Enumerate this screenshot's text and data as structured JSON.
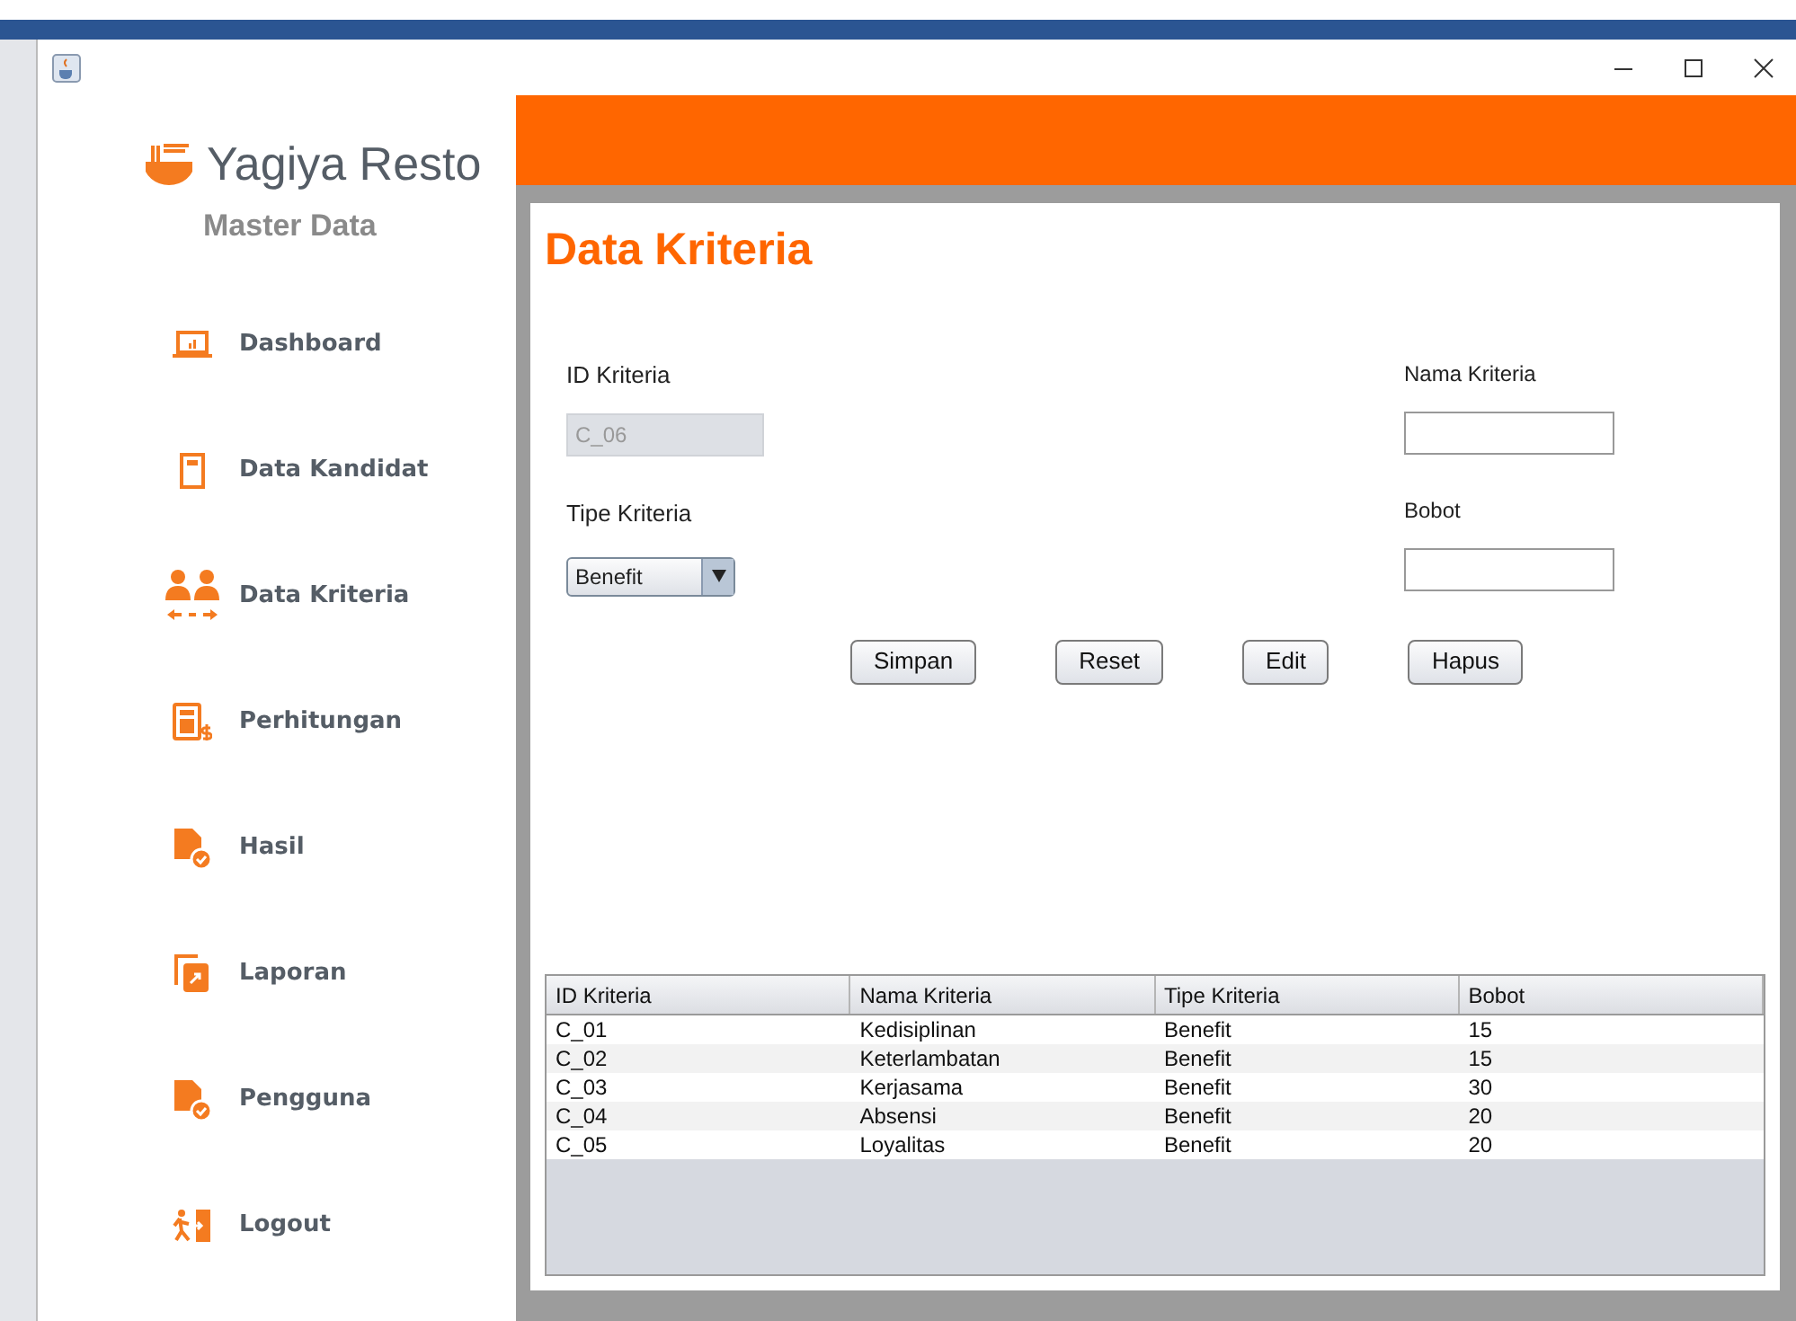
{
  "app": {
    "name": "Yagiya Resto",
    "section": "Master Data"
  },
  "sidebar": {
    "items": [
      {
        "label": "Dashboard",
        "kind": "laptop"
      },
      {
        "label": "Data Kandidat",
        "kind": "card"
      },
      {
        "label": "Data Kriteria",
        "kind": "people"
      },
      {
        "label": "Perhitungan",
        "kind": "calculator"
      },
      {
        "label": "Hasil",
        "kind": "doccheck"
      },
      {
        "label": "Laporan",
        "kind": "copy"
      },
      {
        "label": "Pengguna",
        "kind": "doccheck"
      },
      {
        "label": "Logout",
        "kind": "exit"
      }
    ]
  },
  "page": {
    "title": "Data Kriteria"
  },
  "form": {
    "id_label": "ID Kriteria",
    "id_value": "C_06",
    "id_disabled": true,
    "type_label": "Tipe Kriteria",
    "type_value": "Benefit",
    "name_label": "Nama Kriteria",
    "weight_label": "Bobot"
  },
  "buttons": [
    "Simpan",
    "Reset",
    "Edit",
    "Hapus"
  ],
  "table": {
    "columns": [
      "ID Kriteria",
      "Nama Kriteria",
      "Tipe Kriteria",
      "Bobot"
    ],
    "rows": [
      [
        "C_01",
        "Kedisiplinan",
        "Benefit",
        "15"
      ],
      [
        "C_02",
        "Keterlambatan",
        "Benefit",
        "15"
      ],
      [
        "C_03",
        "Kerjasama",
        "Benefit",
        "30"
      ],
      [
        "C_04",
        "Absensi",
        "Benefit",
        "20"
      ],
      [
        "C_05",
        "Loyalitas",
        "Benefit",
        "20"
      ]
    ]
  }
}
